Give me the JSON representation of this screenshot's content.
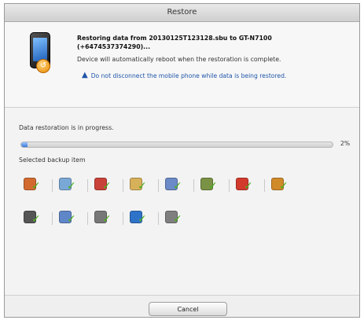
{
  "window": {
    "title": "Restore"
  },
  "info": {
    "line1": "Restoring data from 20130125T123128.sbu to GT-N7100",
    "line2": "(+6474537374290)...",
    "line3": "Device will automatically reboot when the restoration is complete.",
    "warning": "Do not disconnect the mobile phone while data is being restored."
  },
  "progress": {
    "status": "Data restoration is in progress.",
    "value": 0.02,
    "percent_label": "2%"
  },
  "backup_items": {
    "label": "Selected backup item",
    "row1": [
      {
        "icon": "contacts-icon",
        "color": "#d26a2f"
      },
      {
        "icon": "sms-icon",
        "color": "#7aa8d6"
      },
      {
        "icon": "calendar-icon",
        "color": "#c9423a"
      },
      {
        "icon": "mail-icon",
        "color": "#d7b05a"
      },
      {
        "icon": "call-log-icon",
        "color": "#6b8ac7"
      },
      {
        "icon": "memo-icon",
        "color": "#7a9245"
      },
      {
        "icon": "music-icon",
        "color": "#d23a2c"
      },
      {
        "icon": "photos-icon",
        "color": "#d18a2a"
      }
    ],
    "row2": [
      {
        "icon": "video-icon",
        "color": "#555555"
      },
      {
        "icon": "documents-icon",
        "color": "#5f86c7"
      },
      {
        "icon": "settings-icon",
        "color": "#777777"
      },
      {
        "icon": "internet-icon",
        "color": "#2f73c9"
      },
      {
        "icon": "applications-icon",
        "color": "#7f7f7f"
      }
    ]
  },
  "footer": {
    "cancel_label": "Cancel"
  }
}
